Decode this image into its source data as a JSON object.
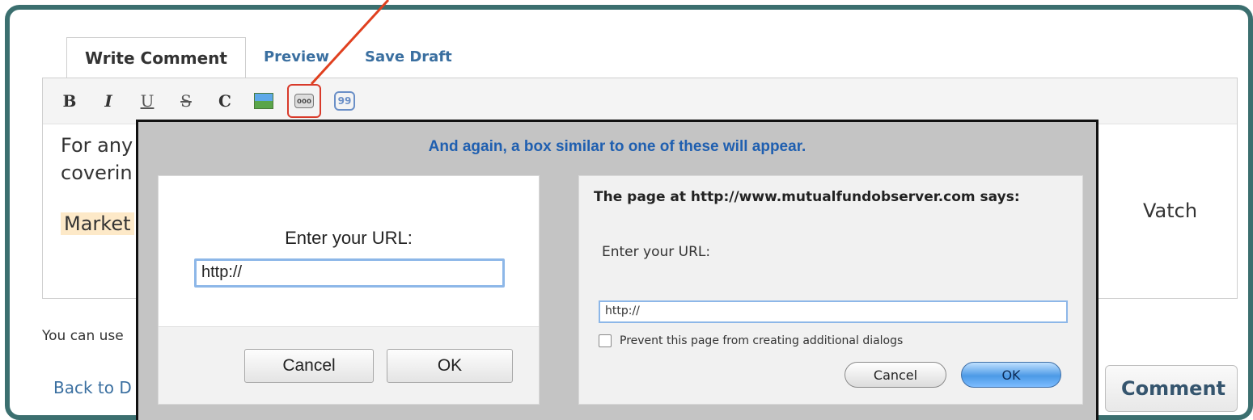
{
  "tabs": [
    {
      "label": "Write Comment"
    },
    {
      "label": "Preview"
    },
    {
      "label": "Save Draft"
    }
  ],
  "toolbar": {
    "bold": "B",
    "italic": "I",
    "underline": "U",
    "strike": "S",
    "code": "C",
    "image_icon": "image-icon",
    "link_icon": "link-icon",
    "link_glyph": "ooo",
    "quote_icon": "quote-icon",
    "quote_glyph": "99"
  },
  "editor": {
    "line1": "For any",
    "line2": "coverin",
    "line3": "Market",
    "right_fragment": "Vatch"
  },
  "below_text": "You can use",
  "back_link": "Back to D",
  "post_button": "Comment",
  "overlay": {
    "caption": "And again, a box similar to one of these will appear.",
    "dialog1": {
      "label": "Enter your URL:",
      "input_value": "http://",
      "cancel": "Cancel",
      "ok": "OK"
    },
    "dialog2": {
      "title": "The page at http://www.mutualfundobserver.com says:",
      "label": "Enter your URL:",
      "input_value": "http://",
      "checkbox_label": "Prevent this page from creating additional dialogs",
      "cancel": "Cancel",
      "ok": "OK"
    }
  },
  "colors": {
    "frame": "#3b6f6f",
    "link": "#3a6fa0",
    "caption": "#1f5fb0",
    "highlight": "#d83a2a"
  }
}
